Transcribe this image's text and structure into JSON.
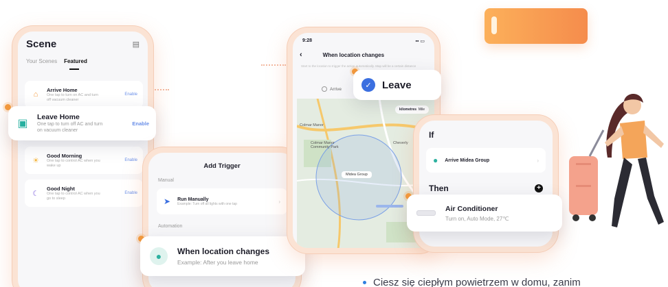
{
  "scene_phone": {
    "title": "Scene",
    "tabs": [
      "Your Scenes",
      "Featured"
    ],
    "items": [
      {
        "title": "Arrive Home",
        "subtitle": "One tap to turn on AC and turn off vacuum cleaner",
        "action": "Enable"
      },
      {
        "title": "Good Morning",
        "subtitle": "One tap to control AC when you wake up",
        "action": "Enable"
      },
      {
        "title": "Good Night",
        "subtitle": "One tap to control AC when you go to sleep",
        "action": "Enable"
      }
    ]
  },
  "leave_home_card": {
    "title": "Leave Home",
    "subtitle": "One tap to turn off AC and turn on vacuum cleaner",
    "action": "Enable"
  },
  "trigger_phone": {
    "title": "Add Trigger",
    "manual_label": "Manual",
    "manual_item": {
      "title": "Run Manually",
      "subtitle": "Example: Turn off all lights with one tap"
    },
    "automation_label": "Automation"
  },
  "when_location_card": {
    "title": "When location changes",
    "subtitle": "Example: After you leave home"
  },
  "map_phone": {
    "time": "9:28",
    "title": "When location changes",
    "note": "Start to the location to trigger the action automatically. Map will be a certain distance",
    "arrive_label": "Arrive",
    "unit_active": "kilometres",
    "unit_other": "Mile",
    "map_labels": [
      "Colmar Manor",
      "Colmar Manor Community Park",
      "Cheverly",
      "Midea Group"
    ],
    "pin_label": "Midea Group"
  },
  "leave_card": {
    "label": "Leave"
  },
  "rule_phone": {
    "if_label": "If",
    "condition": "Arrive Midea Group",
    "then_label": "Then"
  },
  "ac_card": {
    "title": "Air Conditioner",
    "subtitle": "Turn on, Auto Mode, 27℃"
  },
  "bottom_text": "Ciesz się ciepłym powietrzem w domu, zanim"
}
